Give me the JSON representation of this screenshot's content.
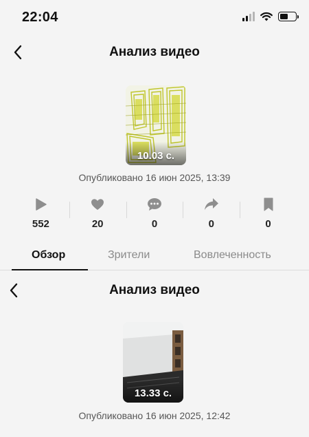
{
  "status_bar": {
    "time": "22:04",
    "battery_level": 0.55
  },
  "screens": [
    {
      "title": "Анализ видео",
      "thumbnail": {
        "duration": "10.03 с.",
        "palette": [
          "#c9cf2e",
          "#e6ea6b",
          "#ffffff"
        ]
      },
      "published": "Опубликовано 16 июн 2025, 13:39",
      "stats": {
        "plays": "552",
        "likes": "20",
        "comments": "0",
        "shares": "0",
        "saves": "0"
      },
      "tabs": [
        "Обзор",
        "Зрители",
        "Вовлеченность"
      ],
      "active_tab": "Обзор"
    },
    {
      "title": "Анализ видео",
      "thumbnail": {
        "duration": "13.33 с.",
        "palette": [
          "#e9eaea",
          "#8a6a4a",
          "#2a2a2a"
        ]
      },
      "published": "Опубликовано 16 июн 2025, 12:42"
    }
  ],
  "icons": {
    "back": "chevron-left-icon",
    "plays": "play-icon",
    "likes": "heart-icon",
    "comments": "comment-bubble-icon",
    "shares": "share-arrow-icon",
    "saves": "bookmark-icon"
  },
  "colors": {
    "icon_gray": "#8e8e8e",
    "text_primary": "#111111",
    "text_secondary": "#555555"
  }
}
